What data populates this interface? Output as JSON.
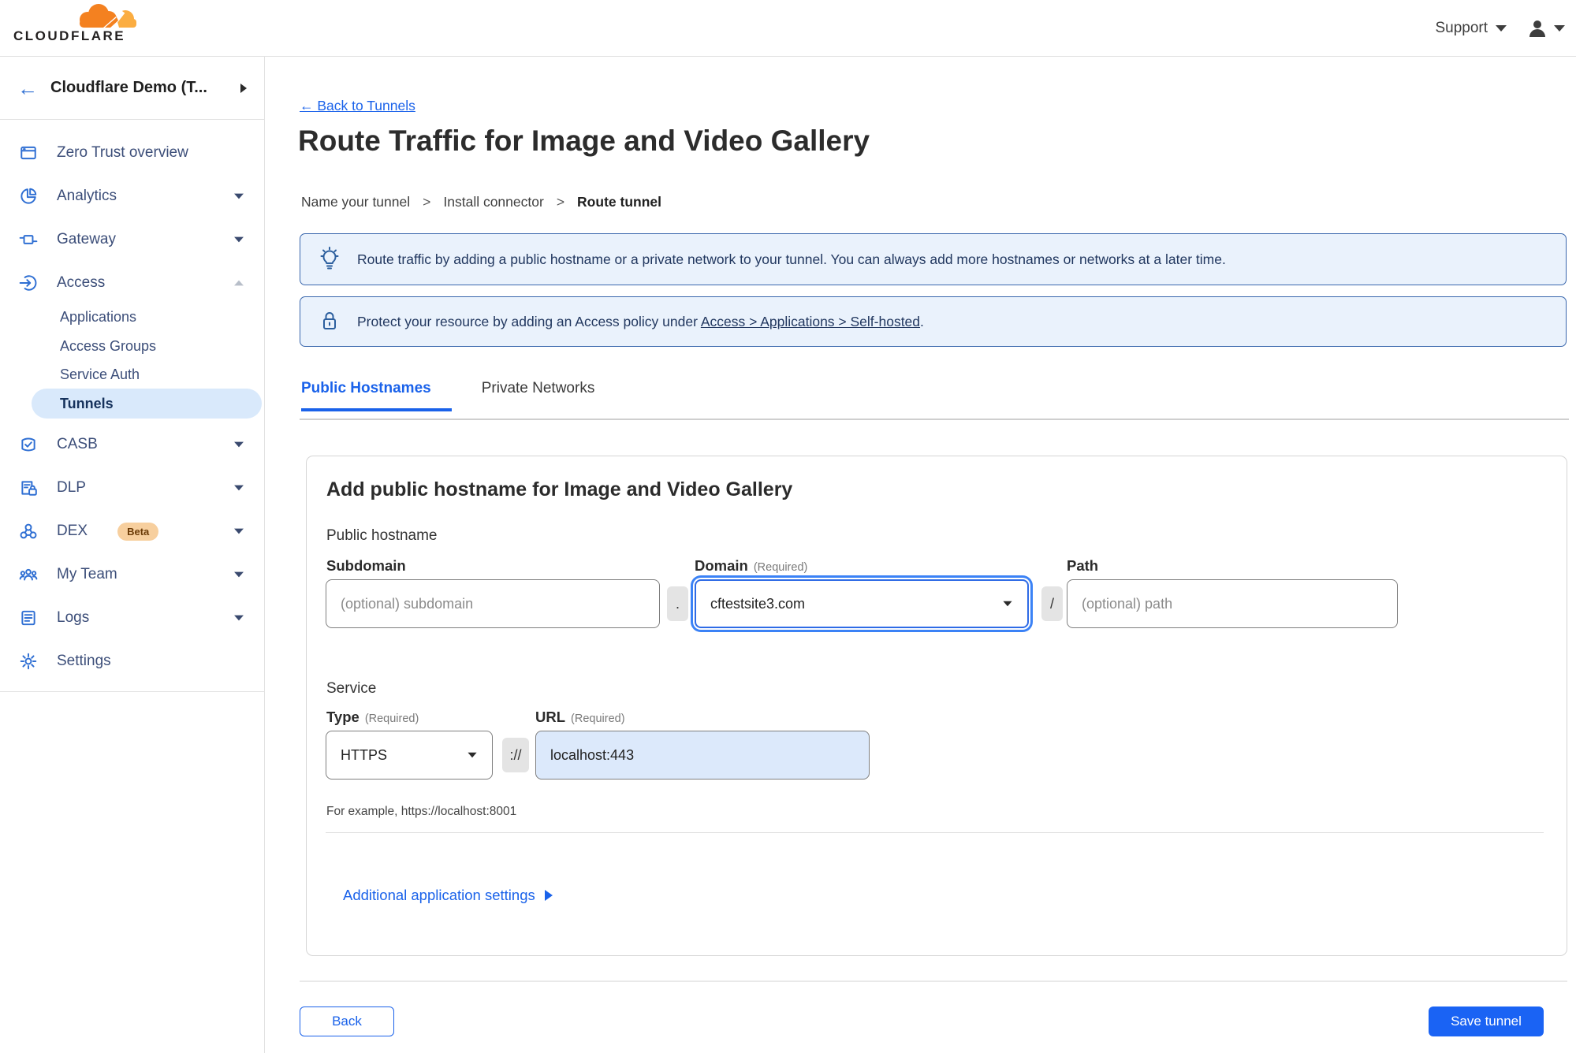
{
  "topbar": {
    "logo_text": "CLOUDFLARE",
    "support_label": "Support"
  },
  "sidebar": {
    "account_name": "Cloudflare Demo (T...",
    "items": [
      {
        "label": "Zero Trust overview"
      },
      {
        "label": "Analytics"
      },
      {
        "label": "Gateway"
      },
      {
        "label": "Access"
      },
      {
        "label": "CASB"
      },
      {
        "label": "DLP"
      },
      {
        "label": "DEX",
        "badge": "Beta"
      },
      {
        "label": "My Team"
      },
      {
        "label": "Logs"
      },
      {
        "label": "Settings"
      }
    ],
    "access_items": [
      {
        "label": "Applications"
      },
      {
        "label": "Access Groups"
      },
      {
        "label": "Service Auth"
      },
      {
        "label": "Tunnels",
        "active": true
      }
    ]
  },
  "header": {
    "back_link": "← Back to Tunnels",
    "title": "Route Traffic for Image and Video Gallery",
    "separator": ">",
    "steps": [
      "Name your tunnel",
      "Install connector",
      "Route tunnel"
    ]
  },
  "banners": [
    {
      "icon": "lightbulb-icon",
      "text": "Route traffic by adding a public hostname or a private network to your tunnel. You can always add more hostnames or networks at a later time."
    },
    {
      "icon": "lock-icon",
      "text_prefix": "Protect your resource by adding an Access policy under",
      "link": "Access > Applications > Self-hosted",
      "text_suffix": "."
    }
  ],
  "tabs": [
    {
      "label": "Public Hostnames",
      "active": true
    },
    {
      "label": "Private Networks",
      "active": false
    }
  ],
  "form": {
    "heading": "Add public hostname for Image and Video Gallery",
    "public_hostname_label": "Public hostname",
    "required_tag": "(Required)",
    "subdomain": {
      "label": "Subdomain",
      "placeholder": "(optional) subdomain",
      "value": ""
    },
    "dot_separator": ".",
    "domain": {
      "label": "Domain",
      "value": "cftestsite3.com"
    },
    "slash_separator": "/",
    "path": {
      "label": "Path",
      "placeholder": "(optional) path",
      "value": ""
    },
    "service_label": "Service",
    "type": {
      "label": "Type",
      "value": "HTTPS"
    },
    "scheme_separator": "://",
    "url": {
      "label": "URL",
      "value": "localhost:443"
    },
    "example_hint": "For example, https://localhost:8001",
    "additional_settings_label": "Additional application settings"
  },
  "footer": {
    "back_label": "Back",
    "save_label": "Save tunnel"
  },
  "icons": [
    "cloudflare-logo",
    "user-icon",
    "chevron-down-icon",
    "back-arrow-icon",
    "overview-icon",
    "analytics-icon",
    "gateway-icon",
    "access-icon",
    "casb-icon",
    "dlp-icon",
    "dex-icon",
    "team-icon",
    "logs-icon",
    "gear-icon",
    "lightbulb-icon",
    "lock-icon"
  ],
  "colors": {
    "accent_blue": "#1a62ea",
    "save_button_blue": "#1a63f4",
    "sidebar_text": "#3c4e79",
    "sidebar_icon_blue": "#2f6fd3",
    "active_pill_bg": "#d9e9fb",
    "banner_bg": "#eaf2fc",
    "banner_border": "#3a67ad",
    "banner_text": "#21375f",
    "beta_badge_bg": "#f7cf9e",
    "url_field_bg": "#dce9fb",
    "logo_orange": "#f48120",
    "logo_light_orange": "#fbad41"
  }
}
